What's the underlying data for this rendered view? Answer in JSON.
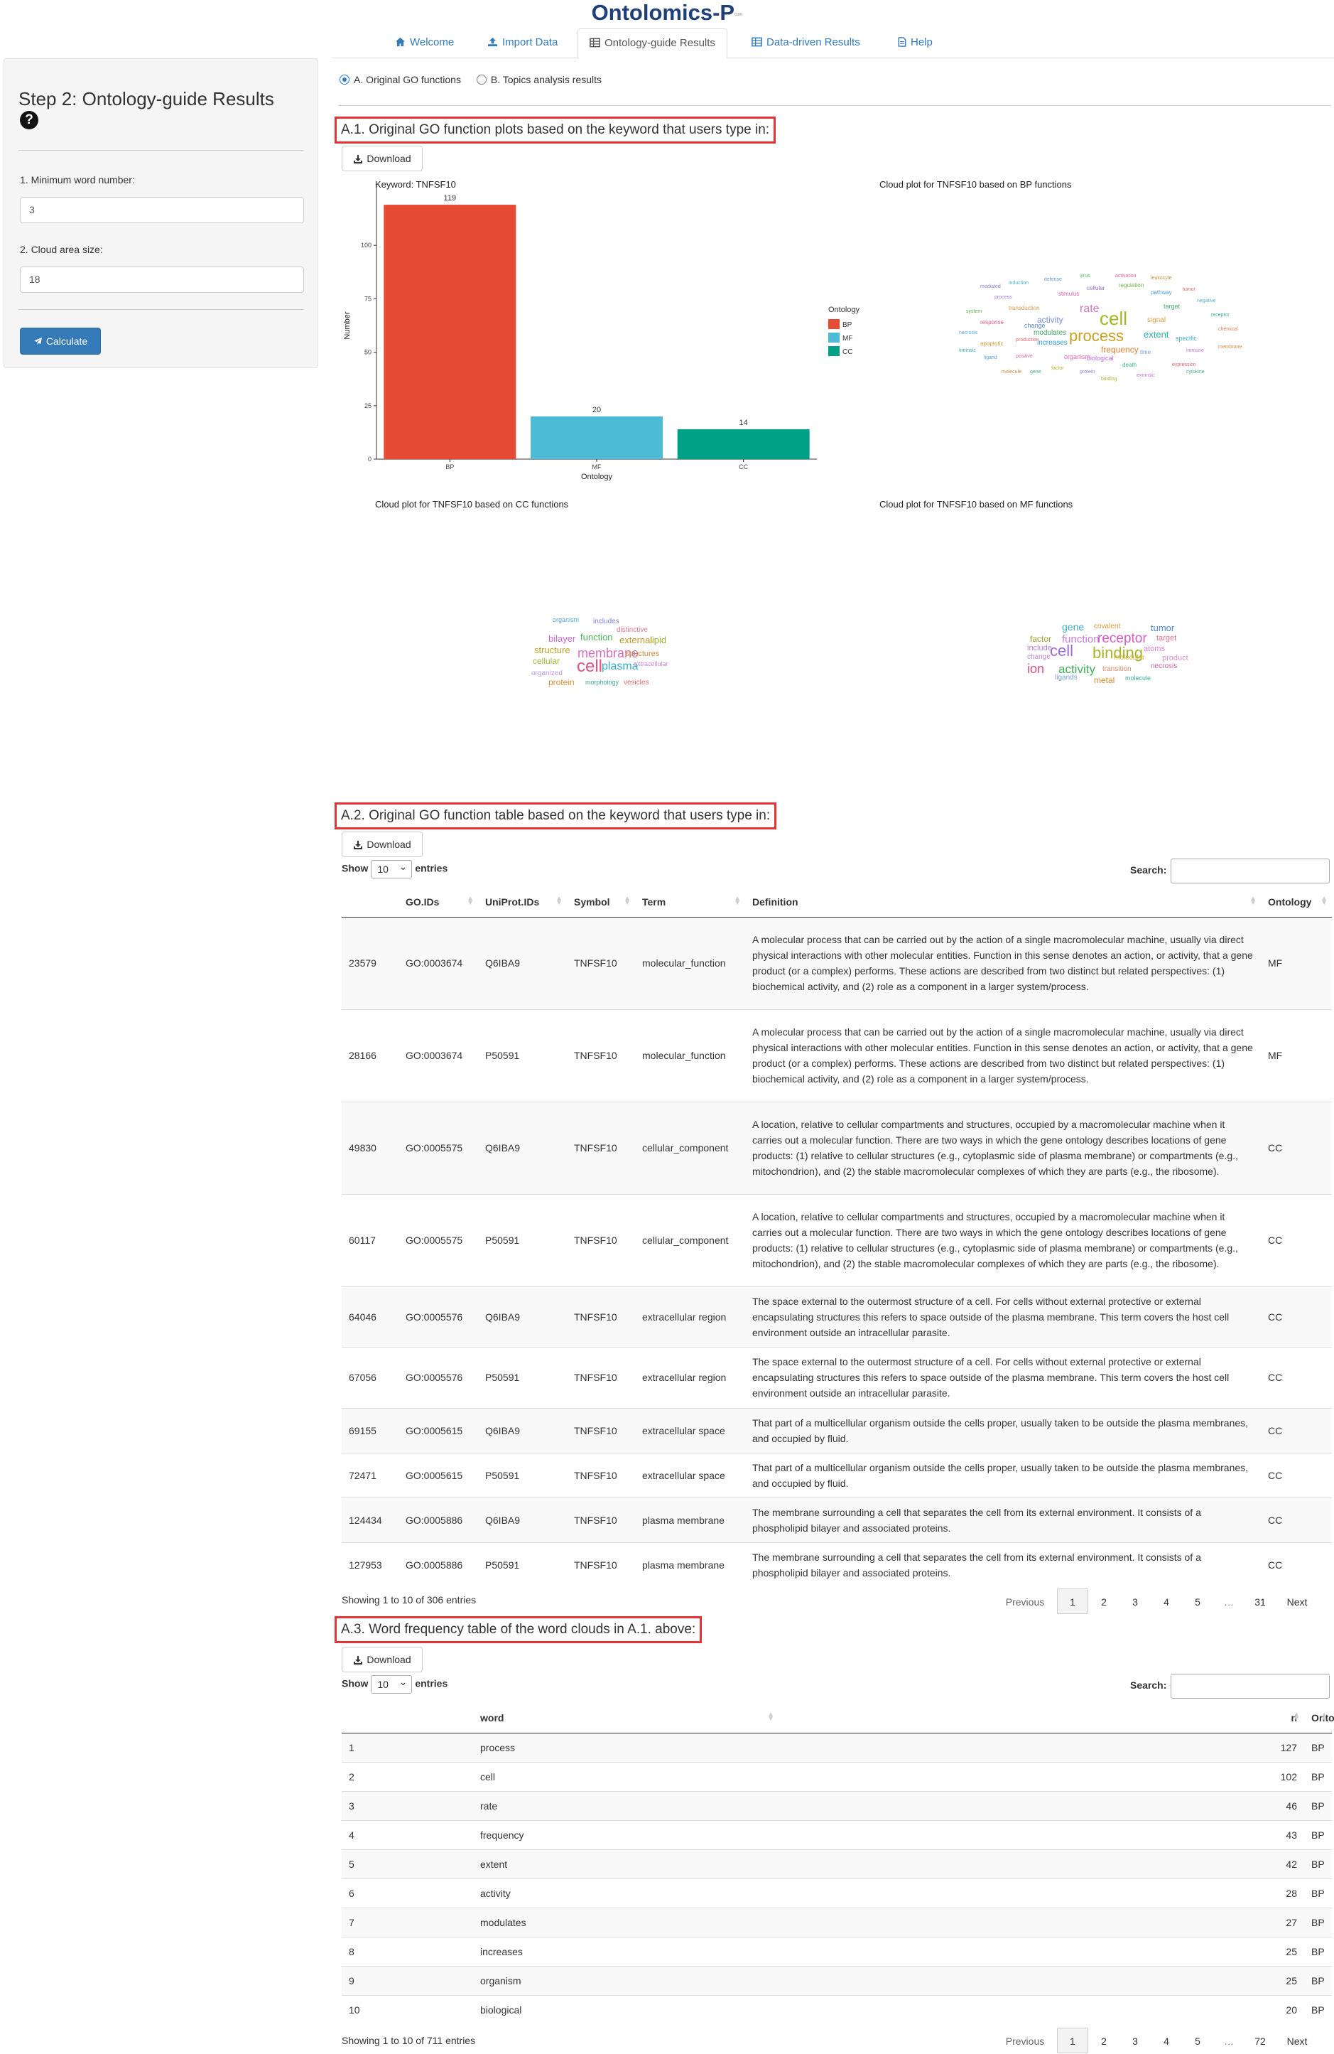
{
  "app": {
    "title": "Ontolomics-P",
    "superscript": "com"
  },
  "tabs": [
    {
      "label": "Welcome",
      "icon": "home-icon",
      "active": false
    },
    {
      "label": "Import Data",
      "icon": "upload-icon",
      "active": false
    },
    {
      "label": "Ontology-guide Results",
      "icon": "table-icon",
      "active": true
    },
    {
      "label": "Data-driven Results",
      "icon": "table-icon",
      "active": false
    },
    {
      "label": "Help",
      "icon": "file-icon",
      "active": false
    }
  ],
  "sidebar": {
    "title": "Step 2: Ontology-guide Results",
    "min_word_label": "1. Minimum word number:",
    "min_word_value": "3",
    "cloud_area_label": "2. Cloud area size:",
    "cloud_area_value": "18",
    "calculate_label": "Calculate"
  },
  "radio": {
    "option_a": "A. Original GO functions",
    "option_b": "B. Topics analysis results",
    "selected": "A"
  },
  "sections": {
    "a1_title": "A.1. Original GO function plots based on the keyword that users type in:",
    "a2_title": "A.2. Original GO function table based on the keyword that users type in:",
    "a3_title": "A.3. Word frequency table of the word clouds in A.1. above:",
    "download_label": "Download"
  },
  "plots": {
    "keyword_title": "Keyword: TNFSF10",
    "bp_cloud_title": "Cloud plot for TNFSF10 based on BP functions",
    "cc_cloud_title": "Cloud plot for TNFSF10 based on CC functions",
    "mf_cloud_title": "Cloud plot for TNFSF10 based on MF functions"
  },
  "chart_data": {
    "type": "bar",
    "title": "Keyword: TNFSF10",
    "xlabel": "Ontology",
    "ylabel": "Number",
    "categories": [
      "BP",
      "MF",
      "CC"
    ],
    "values": [
      119,
      20,
      14
    ],
    "colors": [
      "#e64b35",
      "#4dbbd5",
      "#00a087"
    ],
    "yticks": [
      0,
      25,
      50,
      75,
      100
    ],
    "ylim": [
      0,
      125
    ],
    "legend": {
      "title": "Ontology",
      "entries": [
        "BP",
        "MF",
        "CC"
      ],
      "position": "right"
    },
    "grid": false
  },
  "clouds": {
    "bp": [
      {
        "w": "cell",
        "c": "#9bba1e"
      },
      {
        "w": "process",
        "c": "#c9a020"
      },
      {
        "w": "rate",
        "c": "#cc79c5"
      },
      {
        "w": "activity",
        "c": "#7c8fd6"
      },
      {
        "w": "extent",
        "c": "#2bb3a5"
      },
      {
        "w": "frequency",
        "c": "#e37d2e"
      },
      {
        "w": "modulates",
        "c": "#3aa859"
      },
      {
        "w": "increases",
        "c": "#2d9fd8"
      },
      {
        "w": "organism",
        "c": "#d966b3"
      },
      {
        "w": "biological",
        "c": "#b96ad8"
      },
      {
        "w": "signal",
        "c": "#d9a240"
      },
      {
        "w": "change",
        "c": "#5b8ad1"
      },
      {
        "w": "target",
        "c": "#43b06c"
      },
      {
        "w": "response",
        "c": "#e05a7d"
      },
      {
        "w": "specific",
        "c": "#3eb7c2"
      },
      {
        "w": "cellular",
        "c": "#9b6cd9"
      },
      {
        "w": "transduction",
        "c": "#e0964b"
      },
      {
        "w": "regulation",
        "c": "#71b34c"
      },
      {
        "w": "pathway",
        "c": "#4f9fd9"
      },
      {
        "w": "stimulus",
        "c": "#d45db0"
      },
      {
        "w": "apoptotic",
        "c": "#d49a34"
      },
      {
        "w": "process",
        "c": "#a27cd6"
      },
      {
        "w": "death",
        "c": "#39b38d"
      },
      {
        "w": "tumor",
        "c": "#e06767"
      },
      {
        "w": "necrosis",
        "c": "#5aa7d9"
      },
      {
        "w": "factor",
        "c": "#b9b238"
      },
      {
        "w": "immune",
        "c": "#c674d1"
      },
      {
        "w": "receptor",
        "c": "#3aa9a1"
      },
      {
        "w": "chemical",
        "c": "#de7f52"
      },
      {
        "w": "time",
        "c": "#7a9ed8"
      },
      {
        "w": "system",
        "c": "#57b05a"
      },
      {
        "w": "positive",
        "c": "#d86aa1"
      },
      {
        "w": "negative",
        "c": "#4fb3c9"
      },
      {
        "w": "molecule",
        "c": "#c98e3e"
      },
      {
        "w": "protein",
        "c": "#8c7ed8"
      },
      {
        "w": "gene",
        "c": "#43b378"
      },
      {
        "w": "expression",
        "c": "#e0626f"
      },
      {
        "w": "ligand",
        "c": "#58a2d6"
      },
      {
        "w": "binding",
        "c": "#b0b23a"
      },
      {
        "w": "extrinsic",
        "c": "#c77cd1"
      },
      {
        "w": "intrinsic",
        "c": "#35aeb0"
      },
      {
        "w": "membrane",
        "c": "#df8851"
      },
      {
        "w": "defense",
        "c": "#6f9bd8"
      },
      {
        "w": "virus",
        "c": "#5cb058"
      },
      {
        "w": "activation",
        "c": "#d4689d"
      },
      {
        "w": "induction",
        "c": "#47b3c8"
      },
      {
        "w": "leukocyte",
        "c": "#c2913f"
      },
      {
        "w": "mediated",
        "c": "#937cd6"
      },
      {
        "w": "cytokine",
        "c": "#3fb27e"
      },
      {
        "w": "production",
        "c": "#e06570"
      }
    ],
    "cc": [
      {
        "w": "organism",
        "c": "#5aa7d9"
      },
      {
        "w": "includes",
        "c": "#7a7fd8"
      },
      {
        "w": "distinctive",
        "c": "#d9799a"
      },
      {
        "w": "bilayer",
        "c": "#c76ad4"
      },
      {
        "w": "function",
        "c": "#4fb35a"
      },
      {
        "w": "external",
        "c": "#c09a2a"
      },
      {
        "w": "lipid",
        "c": "#9bb32e"
      },
      {
        "w": "structure",
        "c": "#b9a52a"
      },
      {
        "w": "membrane",
        "c": "#d46fc0"
      },
      {
        "w": "structures",
        "c": "#d48d3a"
      },
      {
        "w": "cellular",
        "c": "#a1b43a"
      },
      {
        "w": "cell",
        "c": "#e0517f"
      },
      {
        "w": "plasma",
        "c": "#2fb0c2"
      },
      {
        "w": "extracellular",
        "c": "#c989d9"
      },
      {
        "w": "organized",
        "c": "#b99ae0"
      },
      {
        "w": "protein",
        "c": "#d4913a"
      },
      {
        "w": "morphology",
        "c": "#3faea0"
      },
      {
        "w": "vesicles",
        "c": "#e06767"
      }
    ],
    "mf": [
      {
        "w": "gene",
        "c": "#3fa9c9"
      },
      {
        "w": "covalent",
        "c": "#d9993a"
      },
      {
        "w": "tumor",
        "c": "#4f8ad6"
      },
      {
        "w": "factor",
        "c": "#98a32a"
      },
      {
        "w": "function",
        "c": "#c77cd9"
      },
      {
        "w": "receptor",
        "c": "#d45dc4"
      },
      {
        "w": "target",
        "c": "#e06f8e"
      },
      {
        "w": "include",
        "c": "#b483d9"
      },
      {
        "w": "cell",
        "c": "#9d6cd9"
      },
      {
        "w": "binding",
        "c": "#a9b42a"
      },
      {
        "w": "atoms",
        "c": "#d986d0"
      },
      {
        "w": "change",
        "c": "#b98ad9"
      },
      {
        "w": "molecular",
        "c": "#c9ad2e"
      },
      {
        "w": "product",
        "c": "#d98cd0"
      },
      {
        "w": "ion",
        "c": "#e0517a"
      },
      {
        "w": "activity",
        "c": "#3fae5a"
      },
      {
        "w": "transition",
        "c": "#d98c6a"
      },
      {
        "w": "necrosis",
        "c": "#c462a0"
      },
      {
        "w": "ligands",
        "c": "#7a9ed8"
      },
      {
        "w": "metal",
        "c": "#e08a2e"
      },
      {
        "w": "molecule",
        "c": "#3faea0"
      }
    ]
  },
  "table1": {
    "show_label": "Show",
    "entries_label": "entries",
    "page_length": "10",
    "search_label": "Search:",
    "columns": [
      "",
      "GO.IDs",
      "UniProt.IDs",
      "Symbol",
      "Term",
      "Definition",
      "Ontology"
    ],
    "rows": [
      [
        "23579",
        "GO:0003674",
        "Q6IBA9",
        "TNFSF10",
        "molecular_function",
        "A molecular process that can be carried out by the action of a single macromolecular machine, usually via direct physical interactions with other molecular entities. Function in this sense denotes an action, or activity, that a gene product (or a complex) performs. These actions are described from two distinct but related perspectives: (1) biochemical activity, and (2) role as a component in a larger system/process.",
        "MF"
      ],
      [
        "28166",
        "GO:0003674",
        "P50591",
        "TNFSF10",
        "molecular_function",
        "A molecular process that can be carried out by the action of a single macromolecular machine, usually via direct physical interactions with other molecular entities. Function in this sense denotes an action, or activity, that a gene product (or a complex) performs. These actions are described from two distinct but related perspectives: (1) biochemical activity, and (2) role as a component in a larger system/process.",
        "MF"
      ],
      [
        "49830",
        "GO:0005575",
        "Q6IBA9",
        "TNFSF10",
        "cellular_component",
        "A location, relative to cellular compartments and structures, occupied by a macromolecular machine when it carries out a molecular function. There are two ways in which the gene ontology describes locations of gene products: (1) relative to cellular structures (e.g., cytoplasmic side of plasma membrane) or compartments (e.g., mitochondrion), and (2) the stable macromolecular complexes of which they are parts (e.g., the ribosome).",
        "CC"
      ],
      [
        "60117",
        "GO:0005575",
        "P50591",
        "TNFSF10",
        "cellular_component",
        "A location, relative to cellular compartments and structures, occupied by a macromolecular machine when it carries out a molecular function. There are two ways in which the gene ontology describes locations of gene products: (1) relative to cellular structures (e.g., cytoplasmic side of plasma membrane) or compartments (e.g., mitochondrion), and (2) the stable macromolecular complexes of which they are parts (e.g., the ribosome).",
        "CC"
      ],
      [
        "64046",
        "GO:0005576",
        "Q6IBA9",
        "TNFSF10",
        "extracellular region",
        "The space external to the outermost structure of a cell. For cells without external protective or external encapsulating structures this refers to space outside of the plasma membrane. This term covers the host cell environment outside an intracellular parasite.",
        "CC"
      ],
      [
        "67056",
        "GO:0005576",
        "P50591",
        "TNFSF10",
        "extracellular region",
        "The space external to the outermost structure of a cell. For cells without external protective or external encapsulating structures this refers to space outside of the plasma membrane. This term covers the host cell environment outside an intracellular parasite.",
        "CC"
      ],
      [
        "69155",
        "GO:0005615",
        "Q6IBA9",
        "TNFSF10",
        "extracellular space",
        "That part of a multicellular organism outside the cells proper, usually taken to be outside the plasma membranes, and occupied by fluid.",
        "CC"
      ],
      [
        "72471",
        "GO:0005615",
        "P50591",
        "TNFSF10",
        "extracellular space",
        "That part of a multicellular organism outside the cells proper, usually taken to be outside the plasma membranes, and occupied by fluid.",
        "CC"
      ],
      [
        "124434",
        "GO:0005886",
        "Q6IBA9",
        "TNFSF10",
        "plasma membrane",
        "The membrane surrounding a cell that separates the cell from its external environment. It consists of a phospholipid bilayer and associated proteins.",
        "CC"
      ],
      [
        "127953",
        "GO:0005886",
        "P50591",
        "TNFSF10",
        "plasma membrane",
        "The membrane surrounding a cell that separates the cell from its external environment. It consists of a phospholipid bilayer and associated proteins.",
        "CC"
      ]
    ],
    "info": "Showing 1 to 10 of 306 entries",
    "pager": {
      "previous": "Previous",
      "pages": [
        "1",
        "2",
        "3",
        "4",
        "5",
        "…",
        "31"
      ],
      "next": "Next",
      "current": "1"
    }
  },
  "table2": {
    "show_label": "Show",
    "entries_label": "entries",
    "page_length": "10",
    "search_label": "Search:",
    "columns": [
      "",
      "word",
      "n",
      "Ontology"
    ],
    "rows": [
      [
        "1",
        "process",
        "127",
        "BP"
      ],
      [
        "2",
        "cell",
        "102",
        "BP"
      ],
      [
        "3",
        "rate",
        "46",
        "BP"
      ],
      [
        "4",
        "frequency",
        "43",
        "BP"
      ],
      [
        "5",
        "extent",
        "42",
        "BP"
      ],
      [
        "6",
        "activity",
        "28",
        "BP"
      ],
      [
        "7",
        "modulates",
        "27",
        "BP"
      ],
      [
        "8",
        "increases",
        "25",
        "BP"
      ],
      [
        "9",
        "organism",
        "25",
        "BP"
      ],
      [
        "10",
        "biological",
        "20",
        "BP"
      ]
    ],
    "info": "Showing 1 to 10 of 711 entries",
    "pager": {
      "previous": "Previous",
      "pages": [
        "1",
        "2",
        "3",
        "4",
        "5",
        "…",
        "72"
      ],
      "next": "Next",
      "current": "1"
    }
  }
}
